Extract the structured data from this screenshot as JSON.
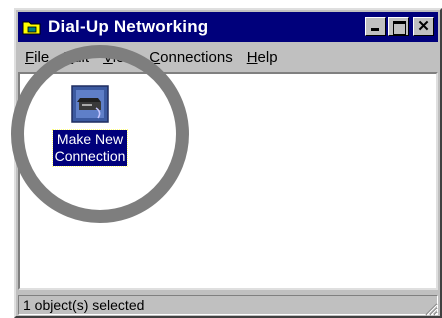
{
  "window": {
    "title": "Dial-Up Networking",
    "title_icon": "folder-phone-icon",
    "controls": [
      "minimize-icon",
      "maximize-icon",
      "close-icon"
    ]
  },
  "menubar": {
    "items": [
      {
        "accel": "F",
        "rest": "ile"
      },
      {
        "accel": "E",
        "rest": "dit"
      },
      {
        "accel": "V",
        "rest": "iew"
      },
      {
        "accel": "C",
        "rest": "onnections"
      },
      {
        "accel": "H",
        "rest": "elp"
      }
    ]
  },
  "content": {
    "items": [
      {
        "label_line1": "Make New",
        "label_line2": "Connection",
        "icon": "make-new-connection-icon",
        "selected": true
      }
    ]
  },
  "statusbar": {
    "text": "1 object(s) selected"
  },
  "colors": {
    "titlebar": "#00007b",
    "face": "#c0c0c0",
    "selection": "#00007b",
    "annotation_circle": "#7e7e7e"
  }
}
